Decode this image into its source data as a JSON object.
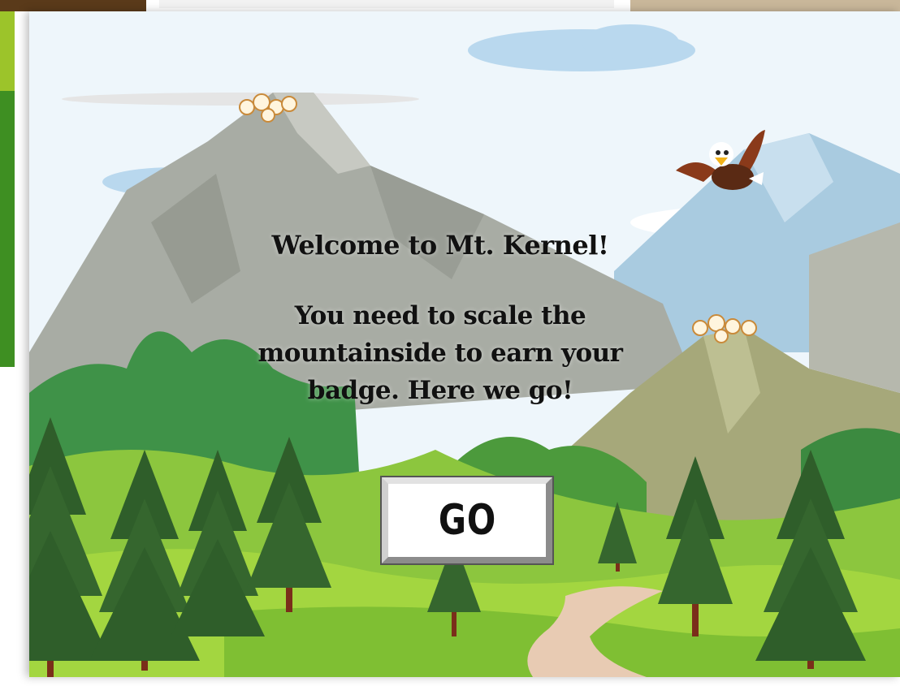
{
  "dialog": {
    "headline": "Welcome to Mt. Kernel!",
    "body": "You need to scale the\nmountainside to earn your\nbadge.  Here we go!",
    "go_button_label": "GO"
  },
  "scene": {
    "sky_color": "#eef6fb",
    "mountain_color": "#a8aca4",
    "forest_color": "#4c9a3c",
    "meadow_color": "#9fd23e",
    "path_color": "#e8cbb3",
    "icons": [
      "eagle-icon",
      "popcorn-icon",
      "pine-tree-icon",
      "cloud-icon"
    ]
  }
}
